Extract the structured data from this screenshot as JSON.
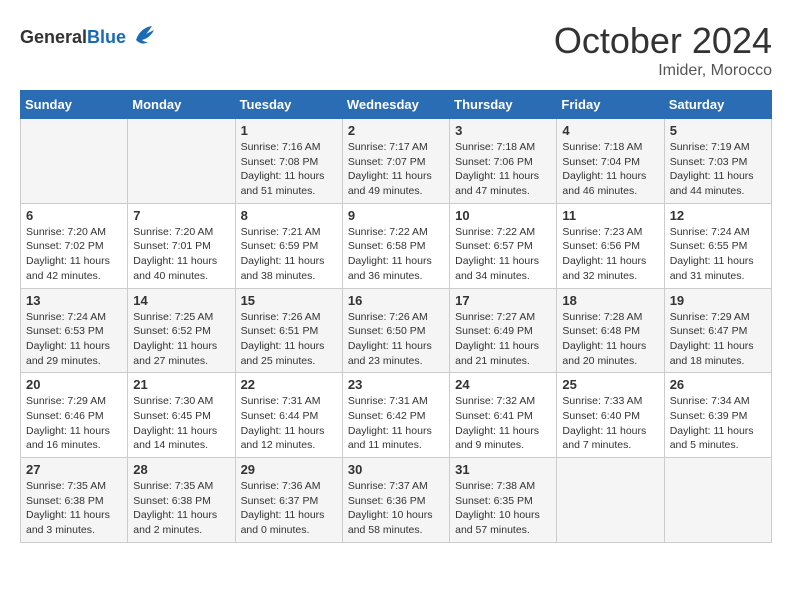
{
  "header": {
    "logo_general": "General",
    "logo_blue": "Blue",
    "month": "October 2024",
    "location": "Imider, Morocco"
  },
  "weekdays": [
    "Sunday",
    "Monday",
    "Tuesday",
    "Wednesday",
    "Thursday",
    "Friday",
    "Saturday"
  ],
  "weeks": [
    [
      {
        "day": "",
        "sunrise": "",
        "sunset": "",
        "daylight": ""
      },
      {
        "day": "",
        "sunrise": "",
        "sunset": "",
        "daylight": ""
      },
      {
        "day": "1",
        "sunrise": "Sunrise: 7:16 AM",
        "sunset": "Sunset: 7:08 PM",
        "daylight": "Daylight: 11 hours and 51 minutes."
      },
      {
        "day": "2",
        "sunrise": "Sunrise: 7:17 AM",
        "sunset": "Sunset: 7:07 PM",
        "daylight": "Daylight: 11 hours and 49 minutes."
      },
      {
        "day": "3",
        "sunrise": "Sunrise: 7:18 AM",
        "sunset": "Sunset: 7:06 PM",
        "daylight": "Daylight: 11 hours and 47 minutes."
      },
      {
        "day": "4",
        "sunrise": "Sunrise: 7:18 AM",
        "sunset": "Sunset: 7:04 PM",
        "daylight": "Daylight: 11 hours and 46 minutes."
      },
      {
        "day": "5",
        "sunrise": "Sunrise: 7:19 AM",
        "sunset": "Sunset: 7:03 PM",
        "daylight": "Daylight: 11 hours and 44 minutes."
      }
    ],
    [
      {
        "day": "6",
        "sunrise": "Sunrise: 7:20 AM",
        "sunset": "Sunset: 7:02 PM",
        "daylight": "Daylight: 11 hours and 42 minutes."
      },
      {
        "day": "7",
        "sunrise": "Sunrise: 7:20 AM",
        "sunset": "Sunset: 7:01 PM",
        "daylight": "Daylight: 11 hours and 40 minutes."
      },
      {
        "day": "8",
        "sunrise": "Sunrise: 7:21 AM",
        "sunset": "Sunset: 6:59 PM",
        "daylight": "Daylight: 11 hours and 38 minutes."
      },
      {
        "day": "9",
        "sunrise": "Sunrise: 7:22 AM",
        "sunset": "Sunset: 6:58 PM",
        "daylight": "Daylight: 11 hours and 36 minutes."
      },
      {
        "day": "10",
        "sunrise": "Sunrise: 7:22 AM",
        "sunset": "Sunset: 6:57 PM",
        "daylight": "Daylight: 11 hours and 34 minutes."
      },
      {
        "day": "11",
        "sunrise": "Sunrise: 7:23 AM",
        "sunset": "Sunset: 6:56 PM",
        "daylight": "Daylight: 11 hours and 32 minutes."
      },
      {
        "day": "12",
        "sunrise": "Sunrise: 7:24 AM",
        "sunset": "Sunset: 6:55 PM",
        "daylight": "Daylight: 11 hours and 31 minutes."
      }
    ],
    [
      {
        "day": "13",
        "sunrise": "Sunrise: 7:24 AM",
        "sunset": "Sunset: 6:53 PM",
        "daylight": "Daylight: 11 hours and 29 minutes."
      },
      {
        "day": "14",
        "sunrise": "Sunrise: 7:25 AM",
        "sunset": "Sunset: 6:52 PM",
        "daylight": "Daylight: 11 hours and 27 minutes."
      },
      {
        "day": "15",
        "sunrise": "Sunrise: 7:26 AM",
        "sunset": "Sunset: 6:51 PM",
        "daylight": "Daylight: 11 hours and 25 minutes."
      },
      {
        "day": "16",
        "sunrise": "Sunrise: 7:26 AM",
        "sunset": "Sunset: 6:50 PM",
        "daylight": "Daylight: 11 hours and 23 minutes."
      },
      {
        "day": "17",
        "sunrise": "Sunrise: 7:27 AM",
        "sunset": "Sunset: 6:49 PM",
        "daylight": "Daylight: 11 hours and 21 minutes."
      },
      {
        "day": "18",
        "sunrise": "Sunrise: 7:28 AM",
        "sunset": "Sunset: 6:48 PM",
        "daylight": "Daylight: 11 hours and 20 minutes."
      },
      {
        "day": "19",
        "sunrise": "Sunrise: 7:29 AM",
        "sunset": "Sunset: 6:47 PM",
        "daylight": "Daylight: 11 hours and 18 minutes."
      }
    ],
    [
      {
        "day": "20",
        "sunrise": "Sunrise: 7:29 AM",
        "sunset": "Sunset: 6:46 PM",
        "daylight": "Daylight: 11 hours and 16 minutes."
      },
      {
        "day": "21",
        "sunrise": "Sunrise: 7:30 AM",
        "sunset": "Sunset: 6:45 PM",
        "daylight": "Daylight: 11 hours and 14 minutes."
      },
      {
        "day": "22",
        "sunrise": "Sunrise: 7:31 AM",
        "sunset": "Sunset: 6:44 PM",
        "daylight": "Daylight: 11 hours and 12 minutes."
      },
      {
        "day": "23",
        "sunrise": "Sunrise: 7:31 AM",
        "sunset": "Sunset: 6:42 PM",
        "daylight": "Daylight: 11 hours and 11 minutes."
      },
      {
        "day": "24",
        "sunrise": "Sunrise: 7:32 AM",
        "sunset": "Sunset: 6:41 PM",
        "daylight": "Daylight: 11 hours and 9 minutes."
      },
      {
        "day": "25",
        "sunrise": "Sunrise: 7:33 AM",
        "sunset": "Sunset: 6:40 PM",
        "daylight": "Daylight: 11 hours and 7 minutes."
      },
      {
        "day": "26",
        "sunrise": "Sunrise: 7:34 AM",
        "sunset": "Sunset: 6:39 PM",
        "daylight": "Daylight: 11 hours and 5 minutes."
      }
    ],
    [
      {
        "day": "27",
        "sunrise": "Sunrise: 7:35 AM",
        "sunset": "Sunset: 6:38 PM",
        "daylight": "Daylight: 11 hours and 3 minutes."
      },
      {
        "day": "28",
        "sunrise": "Sunrise: 7:35 AM",
        "sunset": "Sunset: 6:38 PM",
        "daylight": "Daylight: 11 hours and 2 minutes."
      },
      {
        "day": "29",
        "sunrise": "Sunrise: 7:36 AM",
        "sunset": "Sunset: 6:37 PM",
        "daylight": "Daylight: 11 hours and 0 minutes."
      },
      {
        "day": "30",
        "sunrise": "Sunrise: 7:37 AM",
        "sunset": "Sunset: 6:36 PM",
        "daylight": "Daylight: 10 hours and 58 minutes."
      },
      {
        "day": "31",
        "sunrise": "Sunrise: 7:38 AM",
        "sunset": "Sunset: 6:35 PM",
        "daylight": "Daylight: 10 hours and 57 minutes."
      },
      {
        "day": "",
        "sunrise": "",
        "sunset": "",
        "daylight": ""
      },
      {
        "day": "",
        "sunrise": "",
        "sunset": "",
        "daylight": ""
      }
    ]
  ]
}
